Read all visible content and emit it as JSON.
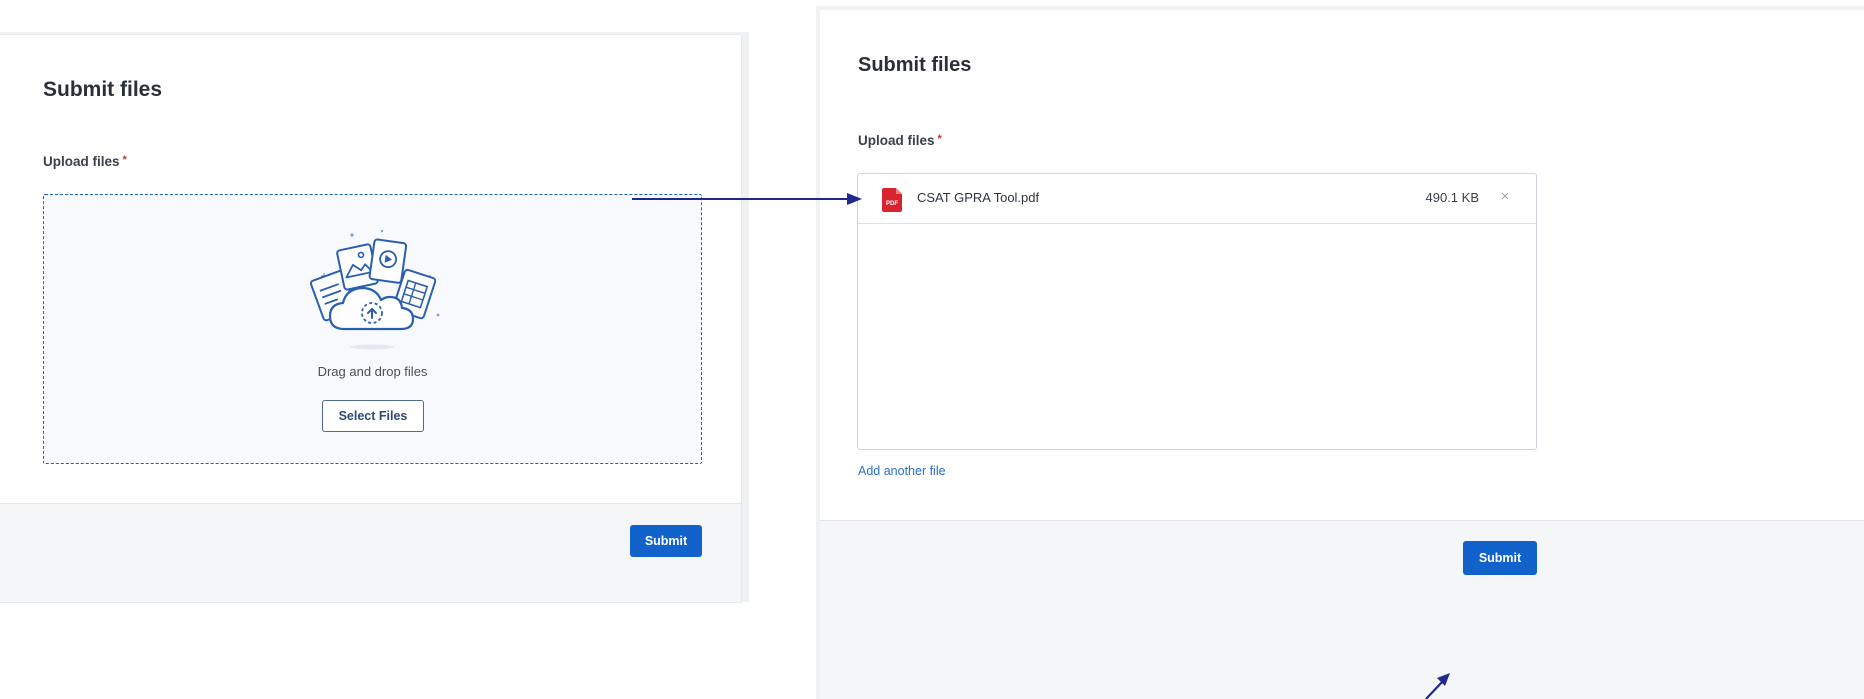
{
  "left_panel": {
    "title": "Submit files",
    "upload_label": "Upload files",
    "required_mark": "*",
    "dropzone_text": "Drag and drop files",
    "select_button_label": "Select Files",
    "submit_label": "Submit"
  },
  "right_panel": {
    "title": "Submit files",
    "upload_label": "Upload files",
    "required_mark": "*",
    "files": [
      {
        "name": "CSAT GPRA Tool.pdf",
        "size": "490.1 KB",
        "icon": "pdf-file-icon",
        "remove_symbol": "×"
      }
    ],
    "add_link": "Add another file",
    "submit_label": "Submit"
  },
  "colors": {
    "primary": "#1262cc",
    "arrow": "#1f2a8a",
    "dropzone_border": "#1f63b8",
    "required": "#d0342c",
    "pdf_red": "#d9232f"
  }
}
